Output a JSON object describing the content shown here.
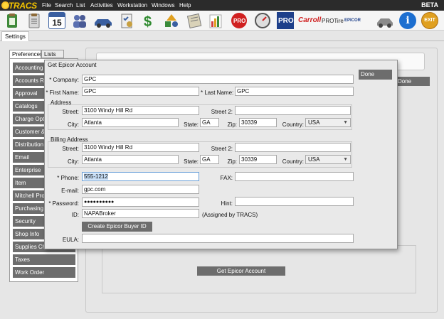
{
  "app": {
    "logo": "TRACS",
    "menu": [
      "File",
      "Search",
      "List",
      "Activities",
      "Workstation",
      "Windows",
      "Help"
    ],
    "badge": "BETA"
  },
  "toolbar": {
    "icons": [
      "clipboard-icon",
      "document-icon",
      "calendar-icon",
      "people-icon",
      "car-icon",
      "checklist-icon",
      "dollar-icon",
      "shapes-icon",
      "notebook-icon",
      "bar-chart-icon",
      "prolink-icon",
      "gauge-icon",
      "pro-icon",
      "carroll-icon",
      "protire-icon",
      "epicor-icon",
      "vehicle-icon",
      "info-icon",
      "exit-icon"
    ],
    "calendar_day": "15",
    "pro_label": "PRO",
    "carroll_label": "Carroll",
    "protire_label": "PROTire",
    "epicor_label": "EPICOR",
    "exit_label": "EXIT",
    "info_label": "i"
  },
  "tabs": {
    "settings": "Settings"
  },
  "preferences": {
    "tabs": [
      "Preferences",
      "Lists"
    ],
    "items": [
      "Accounting",
      "Accounts Re",
      "Approval",
      "Catalogs",
      "Charge Optio",
      "Customer &",
      "Distribution",
      "Email",
      "Enterprise",
      "Item",
      "Mitchell Pro",
      "Purchasing",
      "Security",
      "Shop Info",
      "Supplies Cha",
      "Taxes",
      "Work Order"
    ]
  },
  "background": {
    "done_label": "Done",
    "get_account_label": "Get Epicor Account"
  },
  "dialog": {
    "title": "Get Epicor Account",
    "done_label": "Done",
    "company": {
      "label": "* Company:",
      "value": "GPC"
    },
    "first_name": {
      "label": "* First Name:",
      "value": "GPC"
    },
    "last_name": {
      "label": "* Last Name:",
      "value": "GPC"
    },
    "address": {
      "section": "Address",
      "street_label": "Street:",
      "street": "3100 Windy Hill Rd",
      "street2_label": "Street 2:",
      "street2": "",
      "city_label": "City:",
      "city": "Atlanta",
      "state_label": "State:",
      "state": "GA",
      "zip_label": "Zip:",
      "zip": "30339",
      "country_label": "Country:",
      "country": "USA"
    },
    "billing": {
      "section": "Billing Address",
      "street_label": "Street:",
      "street": "3100 Windy Hill Rd",
      "street2_label": "Street 2:",
      "street2": "",
      "city_label": "City:",
      "city": "Atlanta",
      "state_label": "State:",
      "state": "GA",
      "zip_label": "Zip:",
      "zip": "30339",
      "country_label": "Country:",
      "country": "USA"
    },
    "phone": {
      "label": "* Phone:",
      "value": "555-1212"
    },
    "fax": {
      "label": "FAX:",
      "value": ""
    },
    "email": {
      "label": "E-mail:",
      "value": "gpc.com"
    },
    "password": {
      "label": "* Password:",
      "value": "●●●●●●●●●●"
    },
    "hint": {
      "label": "Hint:",
      "value": ""
    },
    "id": {
      "label": "ID:",
      "value": "NAPABroker",
      "note": "(Assigned by TRACS)"
    },
    "create_label": "Create Epicor Buyer ID",
    "eula": {
      "label": "EULA:",
      "value": ""
    }
  },
  "colors": {
    "menubar": "#2b2b2b",
    "button_gray": "#6d6d6d",
    "highlight": "#c6ddf5"
  }
}
